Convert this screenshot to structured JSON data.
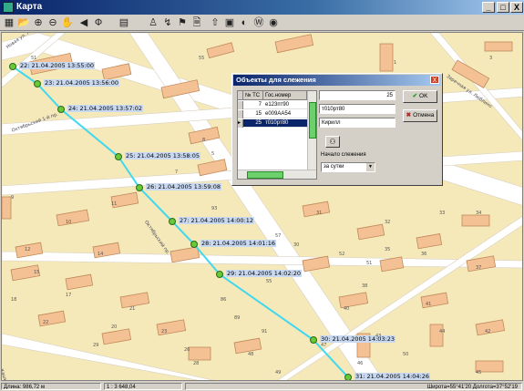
{
  "window": {
    "title": "Карта",
    "minimize": "_",
    "maximize": "□",
    "close": "X"
  },
  "toolbar": [
    {
      "name": "table-icon",
      "glyph": "▦"
    },
    {
      "name": "open-icon",
      "glyph": "📂"
    },
    {
      "name": "zoom-in-icon",
      "glyph": "⊕"
    },
    {
      "name": "zoom-out-icon",
      "glyph": "⊖"
    },
    {
      "name": "pan-hand-icon",
      "glyph": "✋"
    },
    {
      "name": "back-icon",
      "glyph": "◀"
    },
    {
      "name": "stop-icon",
      "glyph": "Ф"
    },
    {
      "name": "layers-icon",
      "glyph": "▤"
    },
    {
      "name": "walker-icon",
      "glyph": "♙"
    },
    {
      "name": "track-icon",
      "glyph": "↯"
    },
    {
      "name": "pin-icon",
      "glyph": "⚑"
    },
    {
      "name": "document-icon",
      "glyph": "🗎"
    },
    {
      "name": "export-icon",
      "glyph": "⇧"
    },
    {
      "name": "grid-icon",
      "glyph": "▣"
    },
    {
      "name": "palette-icon",
      "glyph": "◐"
    },
    {
      "name": "info-icon",
      "glyph": "Ⓦ"
    },
    {
      "name": "target-icon",
      "glyph": "◉"
    }
  ],
  "map": {
    "streets": [
      "Новая ул. Люблино",
      "Октябрьский 1-й пр.",
      "Октябрьский пр.",
      "Заречная ул. Люблино",
      "Каширское ул."
    ],
    "house_numbers": [
      "51",
      "55",
      "1",
      "3",
      "5",
      "7",
      "8",
      "9",
      "10",
      "11",
      "12",
      "14",
      "15",
      "17",
      "18",
      "20",
      "21",
      "22",
      "23",
      "26",
      "28",
      "29",
      "30",
      "31",
      "32",
      "33",
      "34",
      "35",
      "36",
      "37",
      "38",
      "40",
      "41",
      "42",
      "43",
      "44",
      "45",
      "46",
      "47",
      "48",
      "49",
      "50",
      "51",
      "52",
      "55",
      "57",
      "86",
      "89",
      "91",
      "93"
    ],
    "track_points": [
      "22: 21.04.2005 13:55:00",
      "23: 21.04.2005 13:56:00",
      "24: 21.04.2005 13:57:02",
      "25: 21.04.2005 13:58:05",
      "26: 21.04.2005 13:59:08",
      "27: 21.04.2005 14:00:12",
      "28: 21.04.2005 14:01:16",
      "29: 21.04.2005 14:02:20",
      "30: 21.04.2005 14:03:23",
      "31: 21.04.2005 14:04:26"
    ]
  },
  "dialog": {
    "title": "Объекты для слежения",
    "close": "X",
    "columns": [
      "№ ТС",
      "Гос.номер"
    ],
    "rows": [
      {
        "num": "7",
        "plate": "е123пт90"
      },
      {
        "num": "15",
        "plate": "е009АА54"
      },
      {
        "num": "25",
        "plate": "т010рт80"
      }
    ],
    "field_number": "25",
    "field_plate": "т010рт80",
    "field_name": "Кирилл",
    "ok_label": "OK",
    "cancel_label": "Отмена",
    "start_label": "Начало слежения",
    "start_value": "за сутки"
  },
  "status": {
    "distance": "Длина: 986,72 м",
    "scale": "1 : 3 648,04",
    "coords": "Широта=55°41'20  Долгота=37°52'19"
  }
}
